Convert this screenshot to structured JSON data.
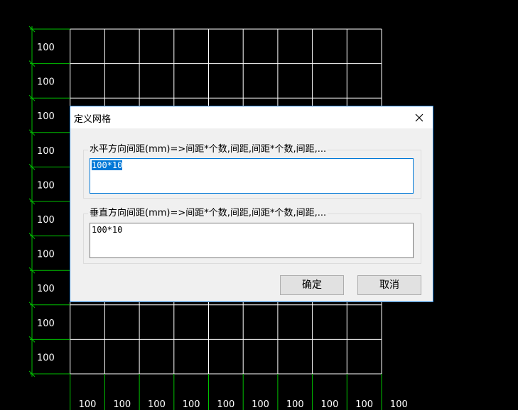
{
  "grid": {
    "left_labels": [
      "100",
      "100",
      "100",
      "100",
      "100",
      "100",
      "100",
      "100",
      "100",
      "100"
    ],
    "bottom_labels": [
      "100",
      "100",
      "100",
      "100",
      "100",
      "100",
      "100",
      "100",
      "100",
      "100"
    ],
    "colors": {
      "background": "#000000",
      "grid_line": "#ffffff",
      "axis_line": "#00c000",
      "label": "#ffffff"
    }
  },
  "dialog": {
    "title": "定义网格",
    "close_glyph": "✕",
    "horizontal": {
      "label": "水平方向间距(mm)=>间距*个数,间距,间距*个数,间距,...",
      "value": "100*10"
    },
    "vertical": {
      "label": "垂直方向间距(mm)=>间距*个数,间距,间距*个数,间距,...",
      "value": "100*10"
    },
    "ok_label": "确定",
    "cancel_label": "取消",
    "colors": {
      "accent": "#0078d7",
      "body": "#f0f0f0",
      "titlebar": "#ffffff"
    }
  }
}
